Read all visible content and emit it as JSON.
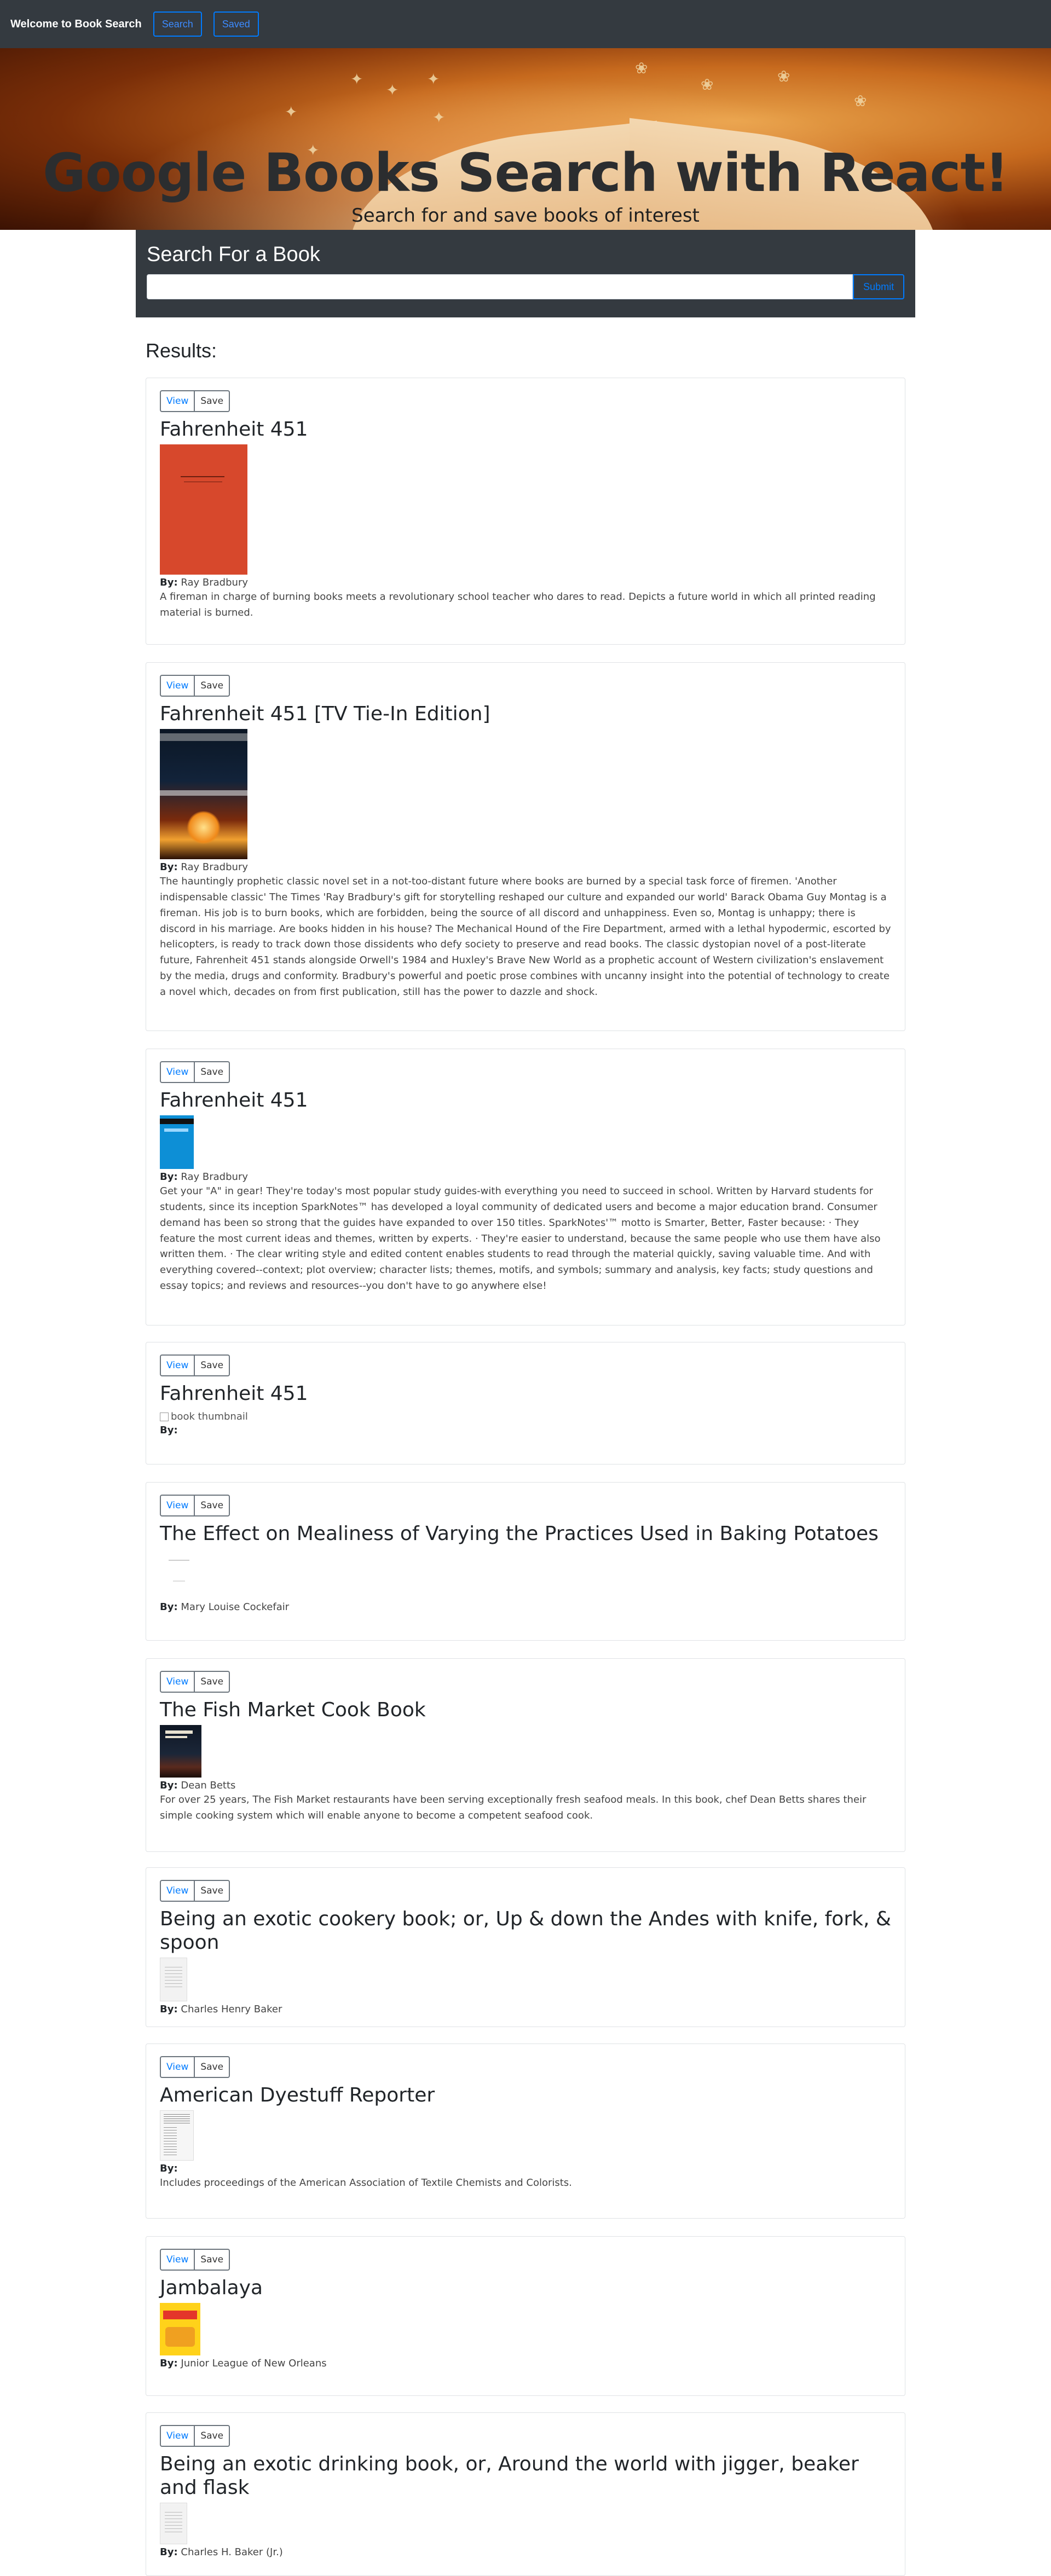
{
  "nav": {
    "brand": "Welcome to Book Search",
    "search": "Search",
    "saved": "Saved"
  },
  "hero": {
    "title": "Google Books Search with React!",
    "subtitle": "Search for and save books of interest"
  },
  "search": {
    "title": "Search For a Book",
    "input_value": "",
    "submit": "Submit"
  },
  "results_title": "Results:",
  "buttons": {
    "view": "View",
    "save": "Save"
  },
  "author_label": "By:",
  "broken_image_alt": "book thumbnail",
  "books": [
    {
      "title": "Fahrenheit 451",
      "author": "Ray Bradbury",
      "description": "A fireman in charge of burning books meets a revolutionary school teacher who dares to read. Depicts a future world in which all printed reading material is burned.",
      "cover": "red-classic"
    },
    {
      "title": "Fahrenheit 451 [TV Tie-In Edition]",
      "author": "Ray Bradbury",
      "description": "The hauntingly prophetic classic novel set in a not-too-distant future where books are burned by a special task force of firemen. 'Another indispensable classic' The Times 'Ray Bradbury's gift for storytelling reshaped our culture and expanded our world' Barack Obama Guy Montag is a fireman. His job is to burn books, which are forbidden, being the source of all discord and unhappiness. Even so, Montag is unhappy; there is discord in his marriage. Are books hidden in his house? The Mechanical Hound of the Fire Department, armed with a lethal hypodermic, escorted by helicopters, is ready to track down those dissidents who defy society to preserve and read books. The classic dystopian novel of a post-literate future, Fahrenheit 451 stands alongside Orwell's 1984 and Huxley's Brave New World as a prophetic account of Western civilization's enslavement by the media, drugs and conformity. Bradbury's powerful and poetic prose combines with uncanny insight into the potential of technology to create a novel which, decades on from first publication, still has the power to dazzle and shock.",
      "cover": "tv-tie-in"
    },
    {
      "title": "Fahrenheit 451",
      "author": "Ray Bradbury",
      "description": "Get your \"A\" in gear! They're today's most popular study guides-with everything you need to succeed in school. Written by Harvard students for students, since its inception SparkNotes™ has developed a loyal community of dedicated users and become a major education brand. Consumer demand has been so strong that the guides have expanded to over 150 titles. SparkNotes'™ motto is Smarter, Better, Faster because: · They feature the most current ideas and themes, written by experts. · They're easier to understand, because the same people who use them have also written them. · The clear writing style and edited content enables students to read through the material quickly, saving valuable time. And with everything covered--context; plot overview; character lists; themes, motifs, and symbols; summary and analysis, key facts; study questions and essay topics; and reviews and resources--you don't have to go anywhere else!",
      "cover": "sparknotes"
    },
    {
      "title": "Fahrenheit 451",
      "author": "",
      "description": "",
      "cover": "broken"
    },
    {
      "title": "The Effect on Mealiness of Varying the Practices Used in Baking Potatoes",
      "author": "Mary Louise Cockefair",
      "description": "",
      "cover": "blank-doc"
    },
    {
      "title": "The Fish Market Cook Book",
      "author": "Dean Betts",
      "description": "For over 25 years, The Fish Market restaurants have been serving exceptionally fresh seafood meals. In this book, chef Dean Betts shares their simple cooking system which will enable anyone to become a competent seafood cook.",
      "cover": "fish-market"
    },
    {
      "title": "Being an exotic cookery book; or, Up & down the Andes with knife, fork, & spoon",
      "author": "Charles Henry Baker",
      "description": "",
      "cover": "text-page"
    },
    {
      "title": "American Dyestuff Reporter",
      "author": "",
      "description": "Includes proceedings of the American Association of Textile Chemists and Colorists.",
      "cover": "dyestuff"
    },
    {
      "title": "Jambalaya",
      "author": "Junior League of New Orleans",
      "description": "",
      "cover": "jambalaya"
    },
    {
      "title": "Being an exotic drinking book, or, Around the world with jigger, beaker and flask",
      "author": "Charles H. Baker (Jr.)",
      "description": "",
      "cover": "text-page"
    }
  ]
}
